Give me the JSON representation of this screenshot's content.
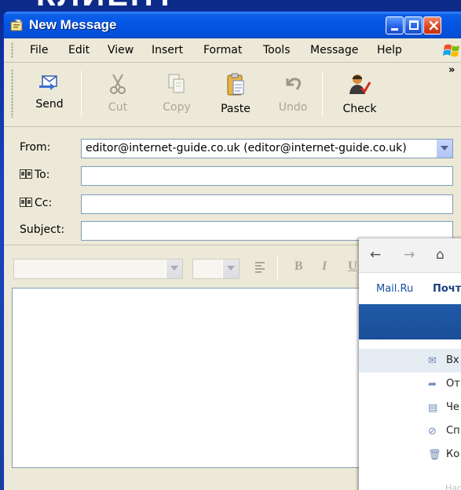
{
  "slide": {
    "heading": "КЛИЕНТ"
  },
  "window": {
    "title": "New Message",
    "controls": {
      "minimize": "",
      "maximize": "",
      "close": "×"
    }
  },
  "menu": [
    "File",
    "Edit",
    "View",
    "Insert",
    "Format",
    "Tools",
    "Message",
    "Help"
  ],
  "toolbar": {
    "overflow": "»",
    "buttons": [
      {
        "label": "Send",
        "icon": "send-icon",
        "enabled": true
      },
      {
        "label": "Cut",
        "icon": "scissors-icon",
        "enabled": false
      },
      {
        "label": "Copy",
        "icon": "copy-icon",
        "enabled": false
      },
      {
        "label": "Paste",
        "icon": "clipboard-icon",
        "enabled": true
      },
      {
        "label": "Undo",
        "icon": "undo-icon",
        "enabled": false
      },
      {
        "label": "Check",
        "icon": "check-names-icon",
        "enabled": true
      }
    ]
  },
  "headers": {
    "from_label": "From:",
    "from_value": "editor@internet-guide.co.uk   (editor@internet-guide.co.uk)",
    "to_label": "To:",
    "to_value": "",
    "cc_label": "Cc:",
    "cc_value": "",
    "subject_label": "Subject:",
    "subject_value": ""
  },
  "format": {
    "bold": "B",
    "italic": "I",
    "underline": "U"
  },
  "message_body": "",
  "browser": {
    "nav": {
      "back": "←",
      "forward": "→",
      "home": "⌂"
    },
    "links": [
      "Mail.Ru",
      "Почт"
    ],
    "folders": [
      {
        "icon": "envelope-icon",
        "glyph": "✉",
        "label": "Вх",
        "selected": true
      },
      {
        "icon": "sent-arrow-icon",
        "glyph": "➦",
        "label": "От",
        "selected": false
      },
      {
        "icon": "draft-icon",
        "glyph": "▤",
        "label": "Че",
        "selected": false
      },
      {
        "icon": "spam-icon",
        "glyph": "⊘",
        "label": "Сп",
        "selected": false
      },
      {
        "icon": "trash-icon",
        "glyph": "🗑",
        "label": "Ко",
        "selected": false
      }
    ],
    "footer": "Наст"
  },
  "colors": {
    "titlebar": "#0554e3",
    "window_face": "#ece9d8",
    "slide_bg": "#1c3f9e",
    "banner": "#1f5aa8"
  }
}
